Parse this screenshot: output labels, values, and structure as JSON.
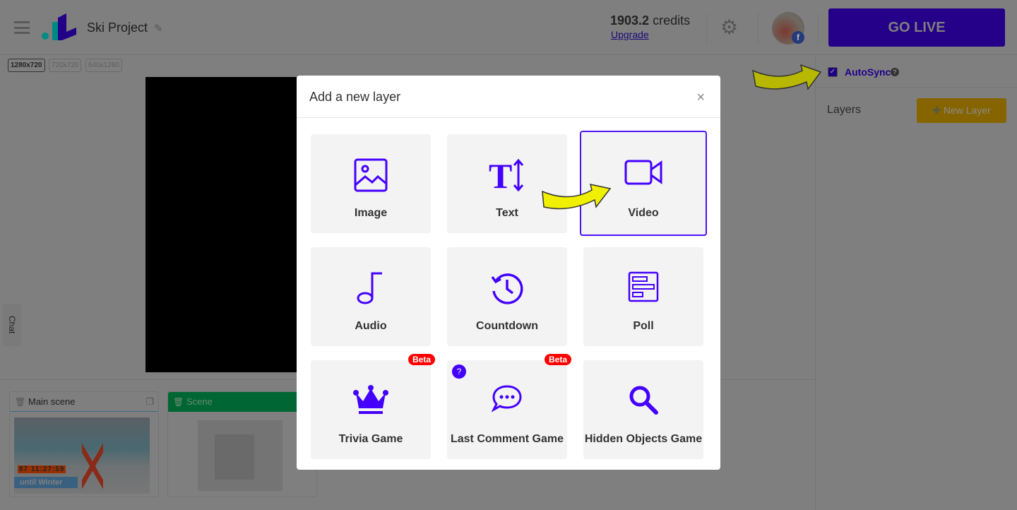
{
  "header": {
    "project_title": "Ski Project",
    "credits_value": "1903.2",
    "credits_unit": "credits",
    "upgrade_label": "Upgrade",
    "go_live_label": "GO LIVE",
    "avatar_badge": "f"
  },
  "resolutions": [
    "1280x720",
    "720x720",
    "640x1280"
  ],
  "right_panel": {
    "autosync_label": "AutoSync",
    "autosync_checked": true,
    "help": "?",
    "layers_label": "Layers",
    "new_layer_label": "New Layer"
  },
  "chat_label": "Chat",
  "scenes": [
    {
      "name": "Main scene",
      "countdown": "87 11:27:59",
      "caption": "until Winter"
    },
    {
      "name": "Scene"
    }
  ],
  "modal": {
    "title": "Add a new layer",
    "close": "×",
    "tiles": [
      {
        "label": "Image",
        "icon": "image-icon"
      },
      {
        "label": "Text",
        "icon": "text-size-icon"
      },
      {
        "label": "Video",
        "icon": "video-camera-icon",
        "selected": true
      },
      {
        "label": "Audio",
        "icon": "music-note-icon"
      },
      {
        "label": "Countdown",
        "icon": "history-clock-icon"
      },
      {
        "label": "Poll",
        "icon": "poll-icon"
      },
      {
        "label": "Trivia Game",
        "icon": "crown-icon",
        "badge": "Beta"
      },
      {
        "label": "Last Comment Game",
        "icon": "comment-dots-icon",
        "badge": "Beta",
        "help": "?"
      },
      {
        "label": "Hidden Objects Game",
        "icon": "search-icon"
      }
    ]
  },
  "colors": {
    "accent": "#4400ff",
    "go_live": "#250088",
    "beta": "#ff0000",
    "new_layer": "#866400",
    "scene_active": "#006633"
  }
}
